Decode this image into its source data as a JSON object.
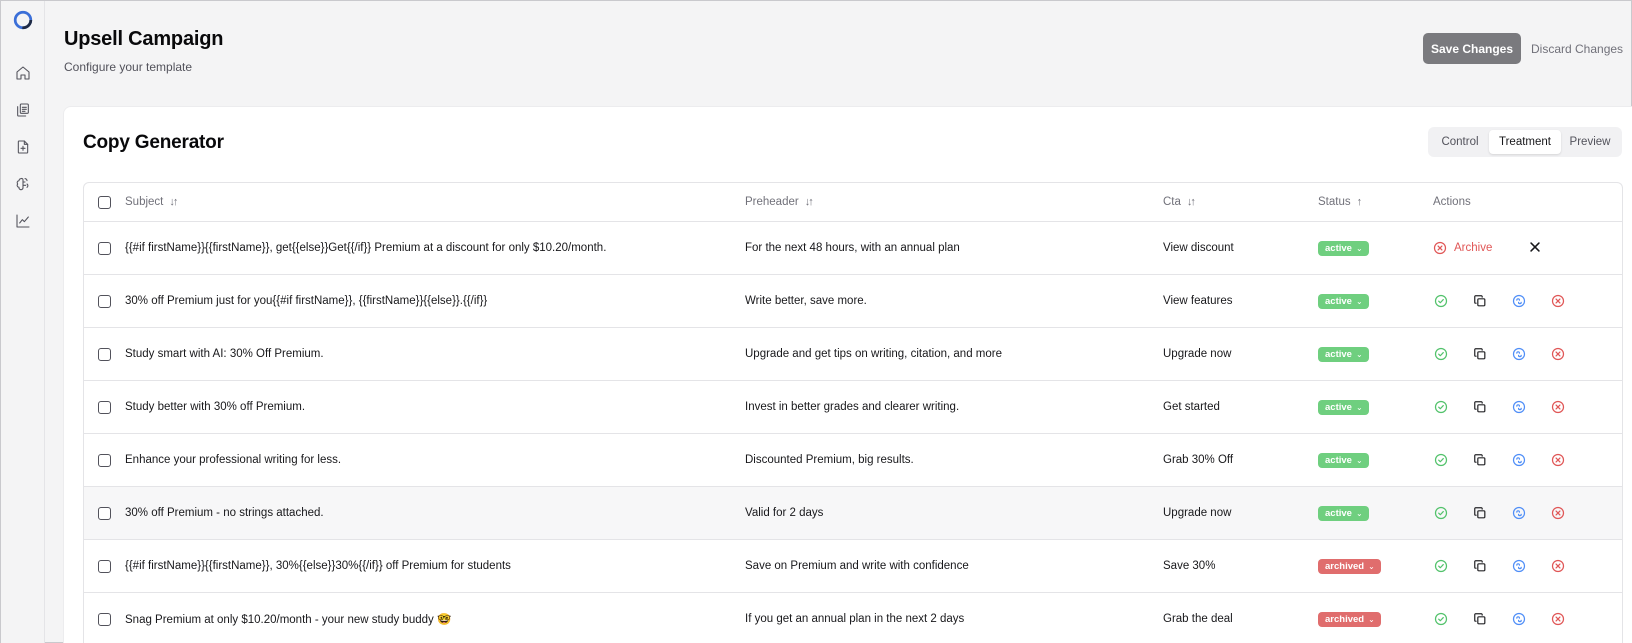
{
  "colors": {
    "accent_gray": "#7a7a7e",
    "active_badge": "#6fcf7f",
    "archived_badge": "#e06d6d",
    "approve_icon": "#52c26b",
    "copy_icon": "#27272a",
    "ai_icon": "#4f8ef7",
    "archive_icon": "#e05656"
  },
  "sidebar": {
    "items": [
      {
        "icon": "home-icon"
      },
      {
        "icon": "copy-files-icon"
      },
      {
        "icon": "file-import-icon"
      },
      {
        "icon": "brain-icon"
      },
      {
        "icon": "chart-line-icon"
      }
    ]
  },
  "header": {
    "title": "Upsell Campaign",
    "subtitle": "Configure your template",
    "save_label": "Save Changes",
    "discard_label": "Discard Changes"
  },
  "card": {
    "title": "Copy Generator",
    "tabs": [
      "Control",
      "Treatment",
      "Preview"
    ],
    "selected_tab": "Treatment"
  },
  "table": {
    "columns": {
      "subject": "Subject",
      "preheader": "Preheader",
      "cta": "Cta",
      "status": "Status",
      "actions": "Actions"
    },
    "sort_icons": {
      "subject": "↓↑",
      "preheader": "↓↑",
      "cta": "↓↑",
      "status": "↑"
    },
    "archive_label": "Archive",
    "rows": [
      {
        "subject": "{{#if firstName}}{{firstName}}, get{{else}}Get{{/if}} Premium at a discount for only $10.20/month.",
        "preheader": "For the next 48 hours, with an annual plan",
        "cta": "View discount",
        "status": "active",
        "status_chevron": "⌄"
      },
      {
        "subject": "30% off Premium just for you{{#if firstName}}, {{firstName}}{{else}}.{{/if}}",
        "preheader": "Write better, save more.",
        "cta": "View features",
        "status": "active",
        "status_chevron": "⌄"
      },
      {
        "subject": "Study smart with AI: 30% Off Premium.",
        "preheader": "Upgrade and get tips on writing, citation, and more",
        "cta": "Upgrade now",
        "status": "active",
        "status_chevron": "⌄"
      },
      {
        "subject": "Study better with 30% off Premium.",
        "preheader": "Invest in better grades and clearer writing.",
        "cta": "Get started",
        "status": "active",
        "status_chevron": "⌄"
      },
      {
        "subject": "Enhance your professional writing for less.",
        "preheader": "Discounted Premium, big results.",
        "cta": "Grab 30% Off",
        "status": "active",
        "status_chevron": "⌄"
      },
      {
        "subject": "30% off Premium - no strings attached.",
        "preheader": "Valid for 2 days",
        "cta": "Upgrade now",
        "status": "active",
        "status_chevron": "⌄"
      },
      {
        "subject": "{{#if firstName}}{{firstName}}, 30%{{else}}30%{{/if}} off Premium for students",
        "preheader": "Save on Premium and write with confidence",
        "cta": "Save 30%",
        "status": "archived",
        "status_chevron": "⌄"
      },
      {
        "subject": "Snag Premium at only $10.20/month - your new study buddy 🤓",
        "preheader": "If you get an annual plan in the next 2 days",
        "cta": "Grab the deal",
        "status": "archived",
        "status_chevron": "⌄"
      }
    ]
  }
}
